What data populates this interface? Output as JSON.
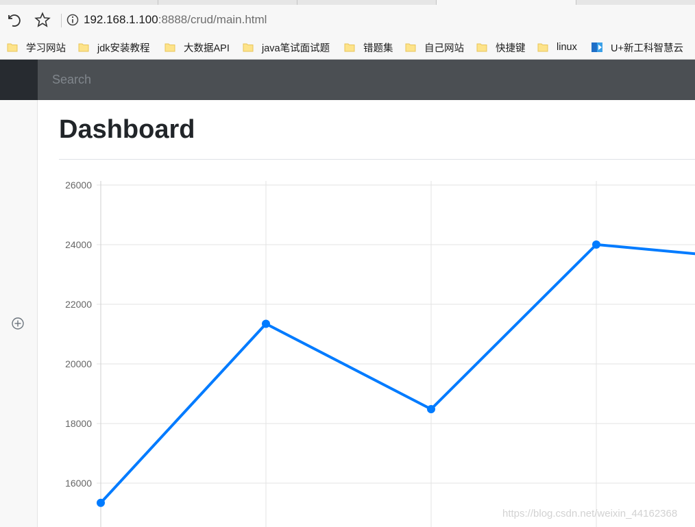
{
  "browser": {
    "url_host": "192.168.1.100",
    "url_rest": ":8888/crud/main.html",
    "bookmarks": [
      {
        "label": "学习网站",
        "icon": "folder-icon"
      },
      {
        "label": "jdk安装教程",
        "icon": "folder-icon"
      },
      {
        "label": "大数据API",
        "icon": "folder-icon"
      },
      {
        "label": "java笔试面试题",
        "icon": "folder-icon"
      },
      {
        "label": "错题集",
        "icon": "folder-icon"
      },
      {
        "label": "自己网站",
        "icon": "folder-icon"
      },
      {
        "label": "快捷键",
        "icon": "folder-icon"
      },
      {
        "label": "linux",
        "icon": "folder-icon"
      },
      {
        "label": "U+新工科智慧云",
        "icon": "site-logo-icon"
      }
    ]
  },
  "navbar": {
    "search_placeholder": "Search"
  },
  "main": {
    "title": "Dashboard"
  },
  "watermark": "https://blog.csdn.net/weixin_44162368",
  "colors": {
    "line": "#007bff",
    "navbar": "#4b4f53",
    "brand": "#272b30"
  },
  "chart_data": {
    "type": "line",
    "y_ticks": [
      16000,
      18000,
      20000,
      22000,
      24000,
      26000
    ],
    "series": [
      {
        "values": [
          15339,
          21345,
          18483,
          24003,
          23489
        ]
      }
    ],
    "grid": true
  }
}
